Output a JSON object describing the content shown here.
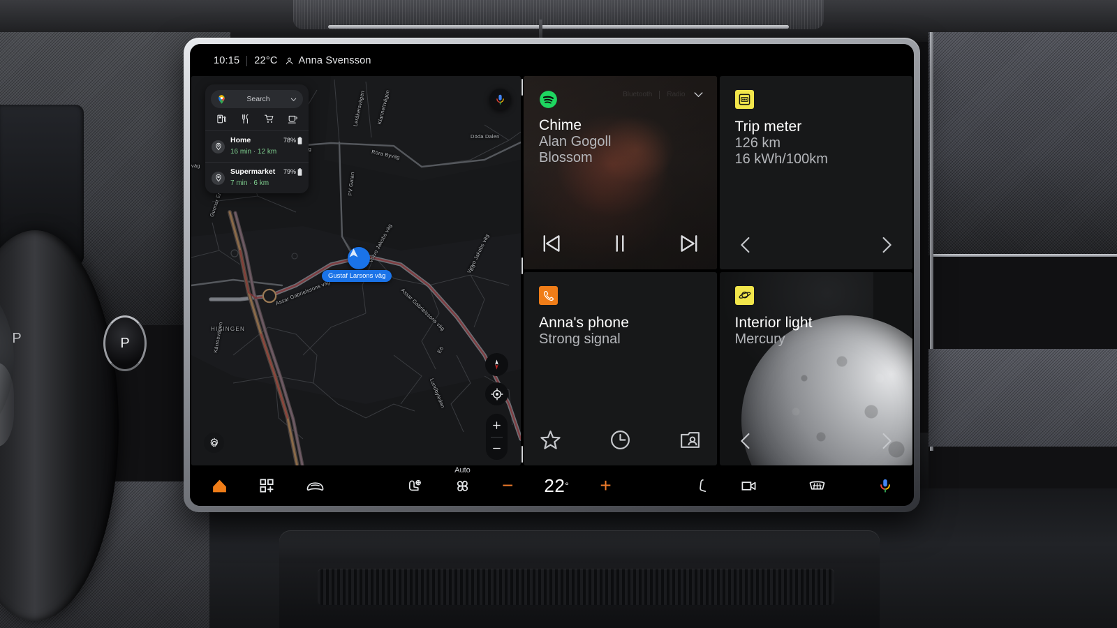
{
  "status_bar": {
    "time": "10:15",
    "temperature": "22°C",
    "user": "Anna Svensson",
    "user_icon": "person-icon"
  },
  "map": {
    "search": {
      "placeholder": "Search",
      "logo_icon": "google-maps-pin-icon",
      "expand_icon": "chevron-down-icon"
    },
    "quick_categories": [
      {
        "name": "gas-station-icon",
        "label": "Gas"
      },
      {
        "name": "restaurant-icon",
        "label": "Restaurants"
      },
      {
        "name": "shopping-cart-icon",
        "label": "Groceries"
      },
      {
        "name": "coffee-icon",
        "label": "Coffee"
      }
    ],
    "destinations": [
      {
        "name": "Home",
        "eta": "16 min",
        "distance": "12 km",
        "battery": "78%",
        "separator": "·"
      },
      {
        "name": "Supermarket",
        "eta": "7 min",
        "distance": "6 km",
        "battery": "79%",
        "separator": "·"
      }
    ],
    "current_road": "Gustaf Larsons väg",
    "controls": {
      "voice_icon": "google-assistant-mic-icon",
      "settings_icon": "gear-icon",
      "compass_icon": "compass-icon",
      "recenter_icon": "recenter-target-icon",
      "zoom_in": "+",
      "zoom_out": "−"
    },
    "street_labels": [
      "Röra Byväg",
      "Röra Byväg",
      "Döda Dalen",
      "PV Gatan",
      "Gunnar Engellaus väg",
      "Volvo Jakobs väg",
      "Volvo Jakobs väg",
      "Assar Gabrielssons väg",
      "Assar Gabrielssons väg",
      "HISINGEN",
      "Kärrosvägen",
      "Leråkersvägen",
      "Klarinettvägen",
      "Lundbyleden",
      "Gustaf Larsons väg",
      "Gustaf Larsons väg",
      "väg",
      "E6",
      "E6"
    ]
  },
  "cards": {
    "media": {
      "app_icon": "spotify-icon",
      "title": "Chime",
      "artist": "Alan Gogoll",
      "album": "Blossom",
      "faint_label_left": "Bluetooth",
      "faint_label_right": "Radio",
      "collapse_icon": "chevron-down-icon",
      "controls": [
        {
          "name": "previous-track-button",
          "glyph": "skip-previous-icon"
        },
        {
          "name": "pause-button",
          "glyph": "pause-icon"
        },
        {
          "name": "next-track-button",
          "glyph": "skip-next-icon"
        }
      ]
    },
    "trip_meter": {
      "icon": "odometer-icon",
      "icon_color": "#f2e64b",
      "title": "Trip meter",
      "distance": "126 km",
      "consumption": "16 kWh/100km",
      "prev_icon": "chevron-left-icon",
      "next_icon": "chevron-right-icon"
    },
    "phone": {
      "icon": "phone-icon",
      "icon_color": "#f07d18",
      "title": "Anna's phone",
      "status": "Strong signal",
      "actions": [
        {
          "name": "favorites-button",
          "glyph": "star-icon"
        },
        {
          "name": "recent-calls-button",
          "glyph": "clock-icon"
        },
        {
          "name": "contacts-button",
          "glyph": "contacts-icon"
        }
      ]
    },
    "interior_light": {
      "icon": "planet-icon",
      "icon_color": "#f2e64b",
      "title": "Interior light",
      "theme": "Mercury",
      "prev_icon": "chevron-left-icon",
      "next_icon": "chevron-right-icon"
    }
  },
  "bottom_bar": {
    "home_icon": "home-icon",
    "home_color": "#f07d18",
    "apps_icon": "apps-grid-plus-icon",
    "car_icon": "car-icon",
    "seat_heater_icon": "seat-heater-icon",
    "fan_label": "Auto",
    "fan_icon": "fan-icon",
    "temp_minus": "−",
    "temp_value": "22",
    "temp_unit": "°",
    "temp_plus": "+",
    "accent_color": "#ee7b2b",
    "passenger_seat_icon": "seat-icon",
    "camera_icon": "camera-icon",
    "defrost_icon": "rear-defrost-icon",
    "assistant_icon": "google-assistant-mic-icon"
  },
  "vehicle": {
    "gear_label": "P",
    "gear_label_secondary": "P"
  }
}
